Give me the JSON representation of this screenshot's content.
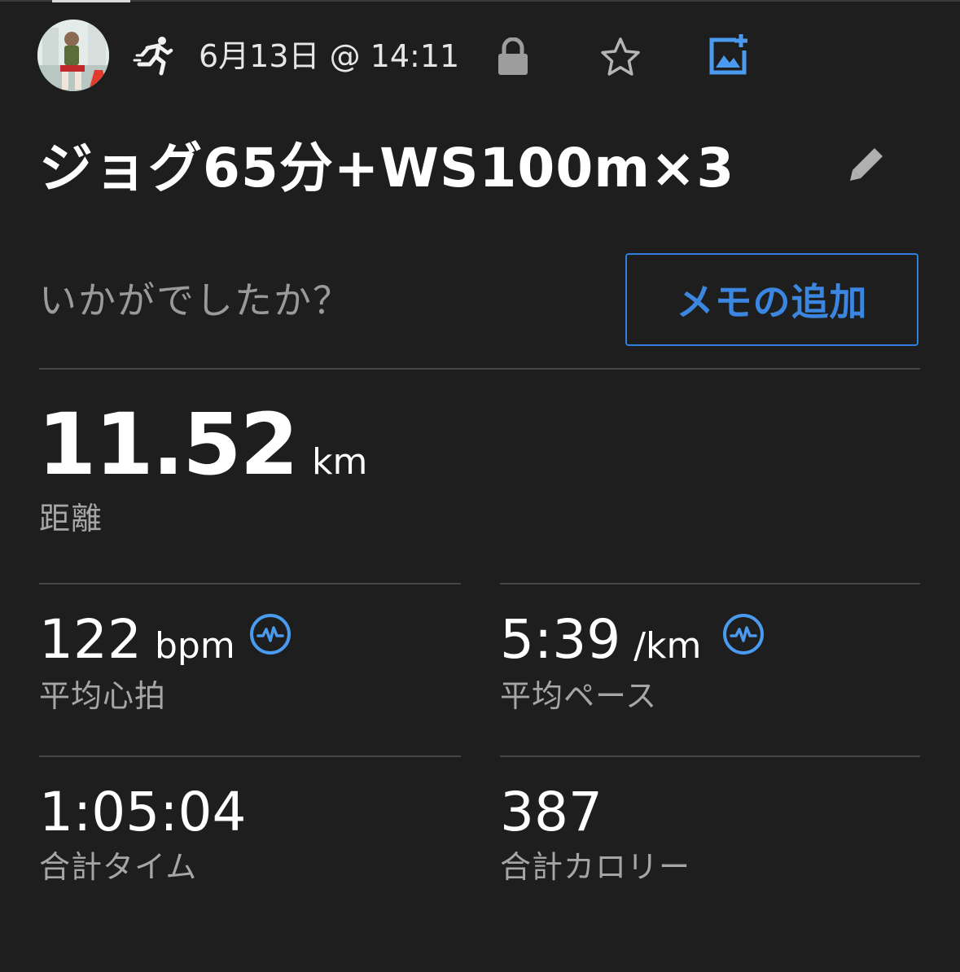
{
  "header": {
    "datetime": "6月13日 @ 14:11",
    "activity_icon": "running-icon",
    "privacy_icon": "lock-icon",
    "favorite_icon": "star-icon",
    "add_photo_icon": "add-photo-icon"
  },
  "activity": {
    "title": "ジョグ65分+WS100m×3",
    "edit_icon": "pencil-icon"
  },
  "feedback": {
    "prompt": "いかがでしたか？",
    "memo_button_label": "メモの追加"
  },
  "stats": {
    "distance": {
      "value": "11.52",
      "unit": "km",
      "label": "距離"
    },
    "heart_rate": {
      "value": "122",
      "unit": "bpm",
      "label": "平均心拍",
      "icon": "pulse-icon"
    },
    "pace": {
      "value": "5:39",
      "unit": "/km",
      "label": "平均ペース",
      "icon": "pulse-icon"
    },
    "time": {
      "value": "1:05:04",
      "label": "合計タイム"
    },
    "calories": {
      "value": "387",
      "label": "合計カロリー"
    }
  },
  "colors": {
    "background": "#1e1e1e",
    "accent": "#3a86e0",
    "icon_blue": "#4a9bf0",
    "text_primary": "#ffffff",
    "text_secondary": "#a6a6a6"
  }
}
